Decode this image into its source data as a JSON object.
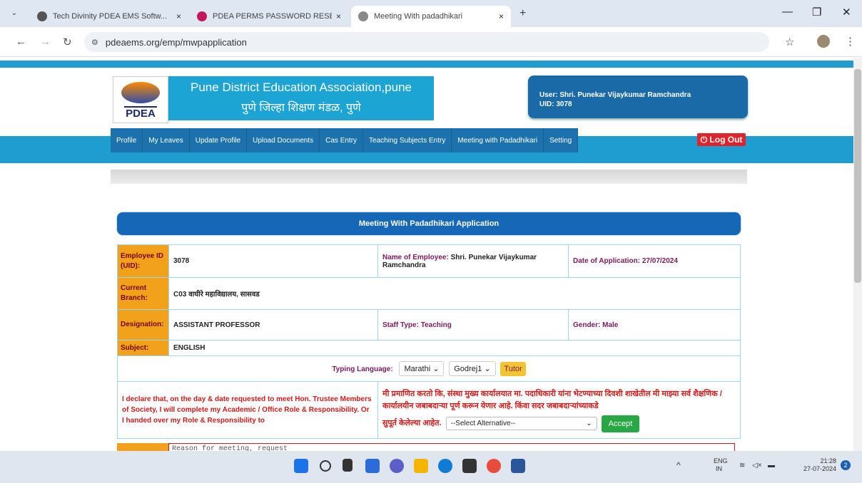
{
  "browser": {
    "tabs": [
      {
        "title": "Tech Divinity PDEA EMS Softw..."
      },
      {
        "title": "PDEA PERMS PASSWORD RESE..."
      },
      {
        "title": "Meeting With padadhikari"
      }
    ],
    "url": "pdeaems.org/emp/mwpapplication"
  },
  "header": {
    "logo_text": "PDEA",
    "title_en": "Pune District Education Association,pune",
    "title_mr": "पुणे जिल्हा शिक्षण मंडळ, पुणे",
    "user_line": "User: Shri. Punekar Vijaykumar Ramchandra",
    "uid_line": "UID: 3078",
    "logout_label": "⏻ Log Out"
  },
  "menu": [
    "Profile",
    "My Leaves",
    "Update Profile",
    "Upload Documents",
    "Cas Entry",
    "Teaching Subjects Entry",
    "Meeting with Padadhikari",
    "Setting"
  ],
  "form": {
    "heading": "Meeting With Padadhikari Application",
    "emp_id_label": "Employee ID (UID):",
    "emp_id_value": "3078",
    "name_label": "Name of Employee:",
    "name_value": "Shri. Punekar Vijaykumar Ramchandra",
    "date_label": "Date of Application:",
    "date_value": "27/07/2024",
    "branch_label": "Current Branch:",
    "branch_value": "C03 वाघीरे महाविद्यालय, सासवड",
    "designation_label": "Designation:",
    "designation_value": "ASSISTANT PROFESSOR",
    "staff_label": "Staff Type:",
    "staff_value": "Teaching",
    "gender_label": "Gender:",
    "gender_value": "Male",
    "subject_label": "Subject:",
    "subject_value": "ENGLISH",
    "typing_label": "Typing Language:",
    "lang_value": "Marathi",
    "keyboard_value": "Godrej1",
    "tutor_label": "Tutor",
    "declaration_en": "I declare that, on the day & date requested to meet Hon. Trustee Members of Society, I will complete my Academic / Office Role & Responsibility. Or I handed over my Role & Responsibility to",
    "declaration_mr": "मी प्रमाणित करतो कि, संस्था मुख्य कार्यालयात मा. पदाधिकारी यांना भेटण्याच्या दिवशी शाखेतील मी माझ्या सर्व शैक्षणिक / कार्यालयीन जबाबदाऱ्या पूर्ण करून येणार आहे. किंवा सदर जबाबदाऱ्यांच्याकडे",
    "declaration_mr_tail": "सुपूर्त केलेल्या आहेत.",
    "alt_select": "--Select Alternative--",
    "accept_label": "Accept",
    "reason_placeholder": "Reason for meeting, request"
  },
  "taskbar": {
    "lang": "ENG",
    "region": "IN",
    "time": "21:28",
    "date": "27-07-2024",
    "badge": "2"
  }
}
